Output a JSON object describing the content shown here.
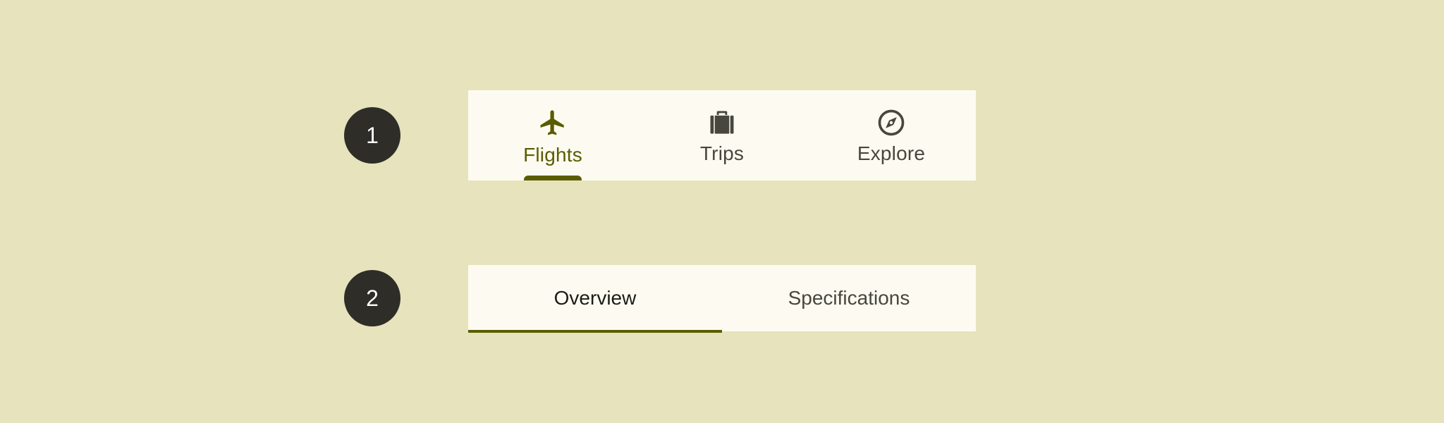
{
  "markers": {
    "first": "1",
    "second": "2"
  },
  "primary_tabs": {
    "items": [
      {
        "label": "Flights",
        "icon": "airplane-icon",
        "active": true
      },
      {
        "label": "Trips",
        "icon": "suitcase-icon",
        "active": false
      },
      {
        "label": "Explore",
        "icon": "compass-icon",
        "active": false
      }
    ]
  },
  "secondary_tabs": {
    "items": [
      {
        "label": "Overview",
        "active": true
      },
      {
        "label": "Specifications",
        "active": false
      }
    ]
  },
  "colors": {
    "background": "#e6e3bd",
    "surface": "#fdfbf1",
    "accent": "#5a5c00",
    "marker": "#2f2d28",
    "inactive_text": "#47473e"
  }
}
